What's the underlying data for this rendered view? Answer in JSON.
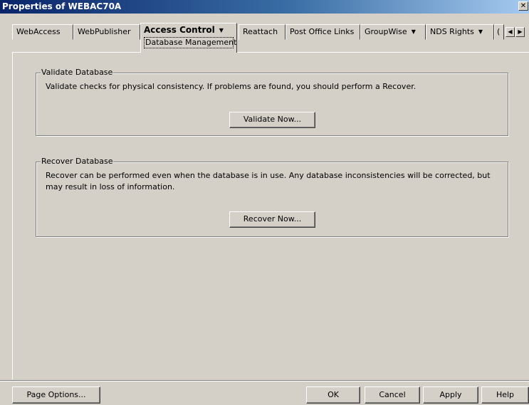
{
  "window": {
    "title": "Properties of WEBAC70A",
    "close_glyph": "✕"
  },
  "tabs": [
    {
      "label": "WebAccess"
    },
    {
      "label": "WebPublisher"
    },
    {
      "label": "Access Control",
      "subtitle": "Database Management",
      "active": true,
      "dropdown": true
    },
    {
      "label": "Reattach"
    },
    {
      "label": "Post Office Links"
    },
    {
      "label": "GroupWise",
      "dropdown": true
    },
    {
      "label": "NDS Rights",
      "dropdown": true
    },
    {
      "label": "("
    }
  ],
  "validate": {
    "legend": "Validate Database",
    "description": "Validate checks for physical consistency. If problems are found, you should perform a Recover.",
    "button": "Validate Now..."
  },
  "recover": {
    "legend": "Recover Database",
    "description": "Recover can be performed even when the database is in use. Any database inconsistencies will be corrected, but may result in loss of information.",
    "button": "Recover Now..."
  },
  "footer": {
    "page_options": "Page Options...",
    "ok": "OK",
    "cancel": "Cancel",
    "apply": "Apply",
    "help": "Help"
  },
  "colors": {
    "face": "#d4d0c8",
    "title_gradient_start": "#0a246a",
    "title_gradient_end": "#a6caf0"
  }
}
